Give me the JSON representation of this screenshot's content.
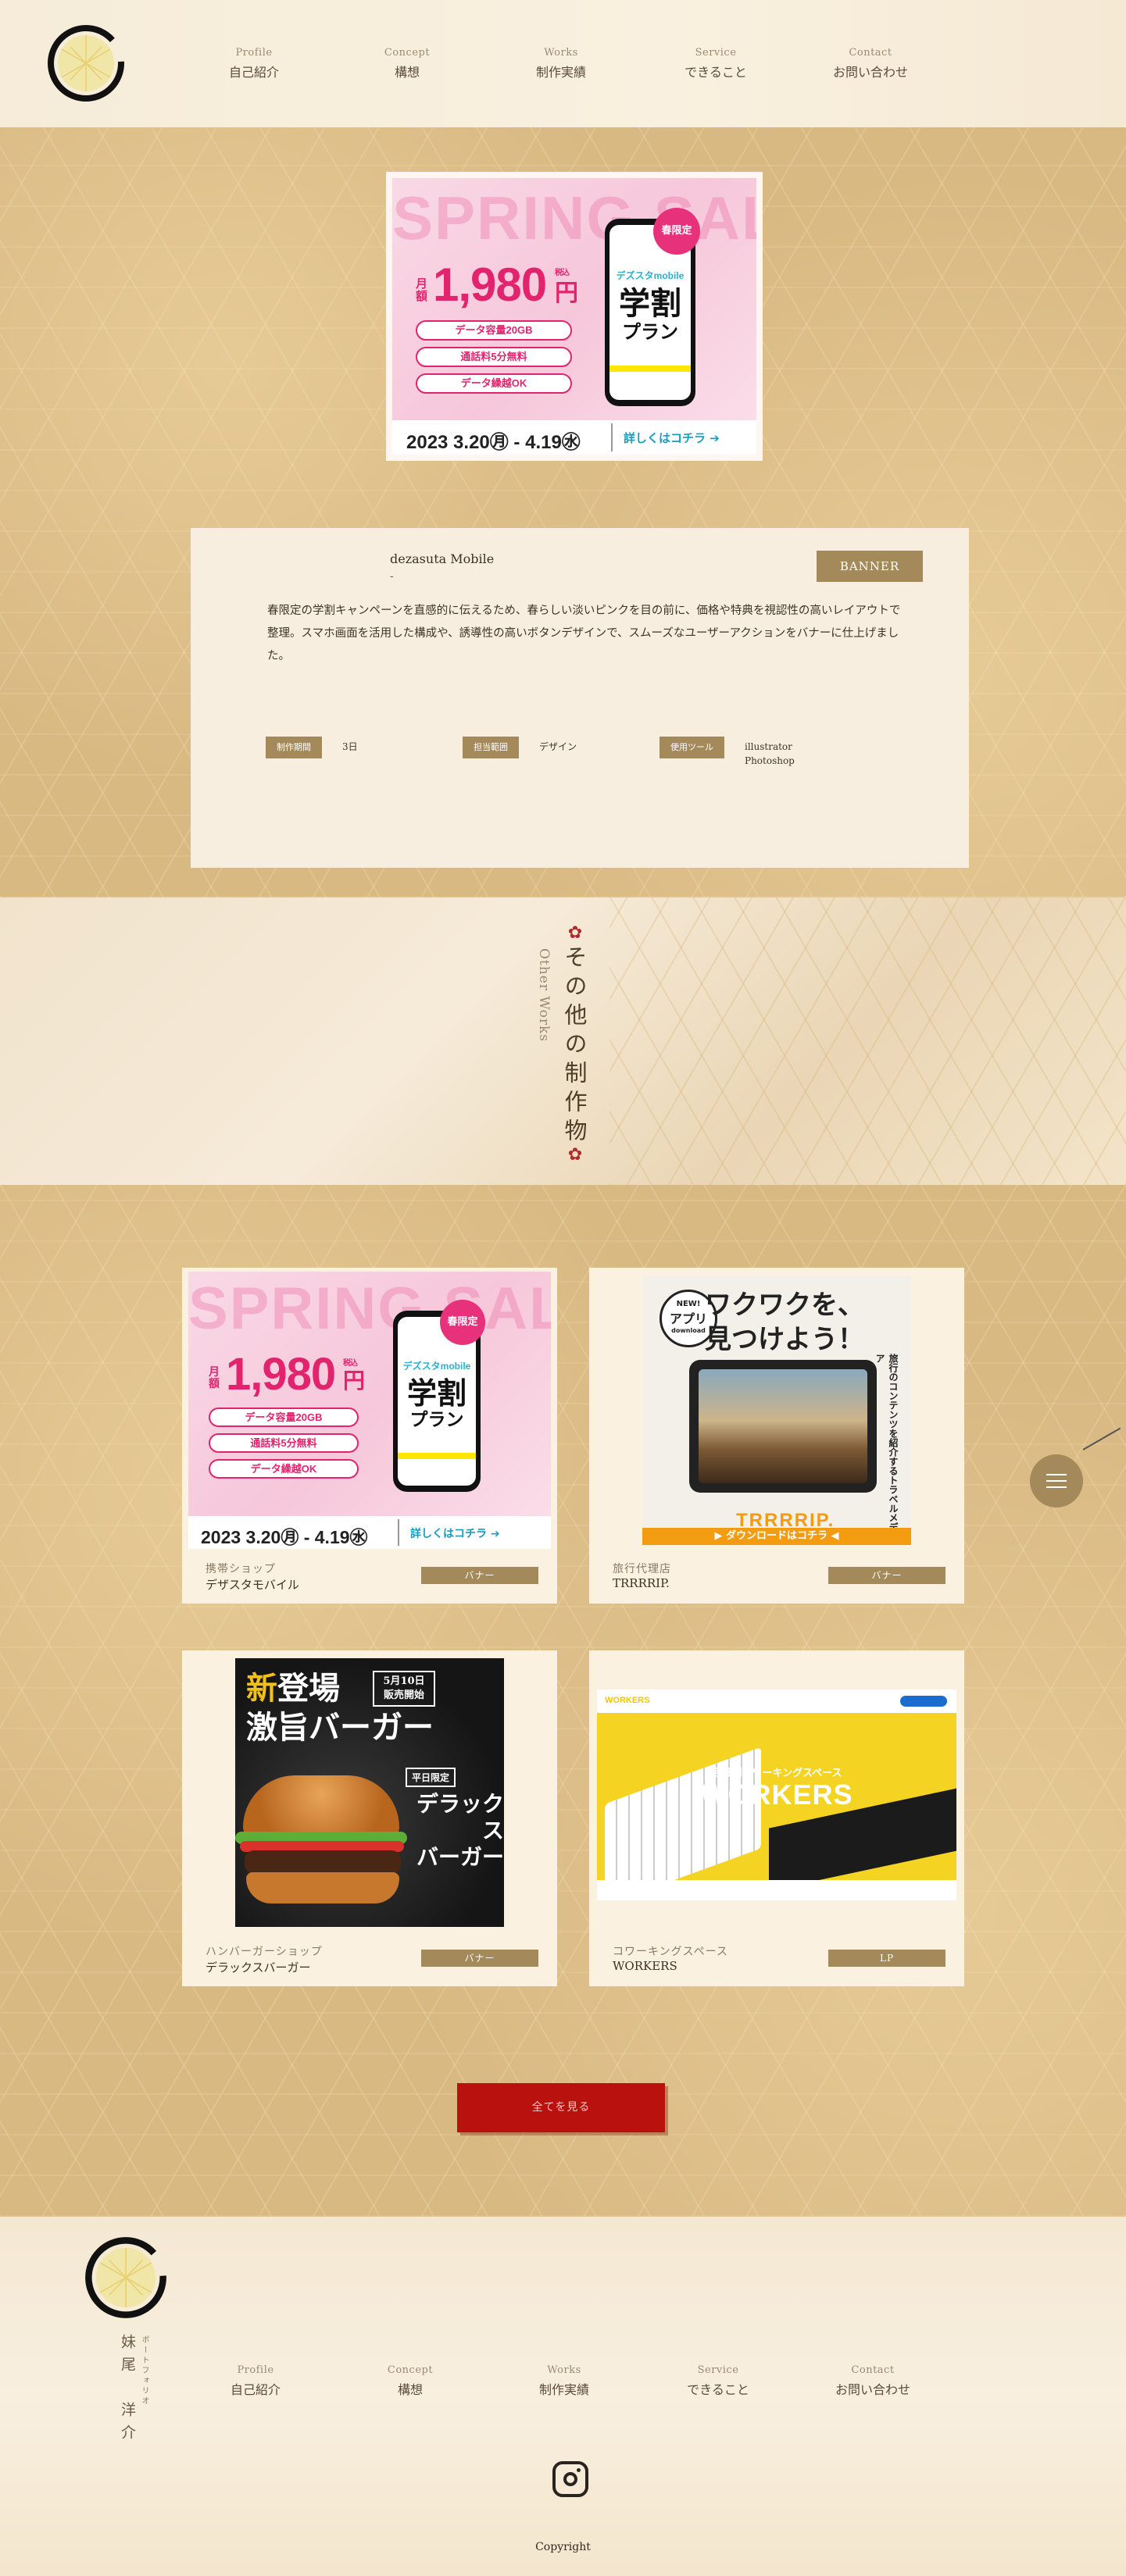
{
  "header": {
    "nav": [
      {
        "en": "Profile",
        "jp": "自己紹介"
      },
      {
        "en": "Concept",
        "jp": "構想"
      },
      {
        "en": "Works",
        "jp": "制作実績"
      },
      {
        "en": "Service",
        "jp": "できること"
      },
      {
        "en": "Contact",
        "jp": "お問い合わせ"
      }
    ]
  },
  "banner": {
    "title_bg": "SPRING SALE",
    "monthly": "月額",
    "price": "1,980",
    "yen": "円",
    "tax": "税込",
    "pills": [
      "データ容量20GB",
      "通話料5分無料",
      "データ繰越OK"
    ],
    "badge": "春限定",
    "brand": "デズスタmobile",
    "plan_big": "学割",
    "plan_small": "プラン",
    "dates": "2023 3.20㊊ - 4.19㊌",
    "cta": "詳しくはコチラ ➔"
  },
  "detail": {
    "client": "dezasuta Mobile",
    "dash": "-",
    "tag": "BANNER",
    "description": "春限定の学割キャンペーンを直感的に伝えるため、春らしい淡いピンクを目の前に、価格や特典を視認性の高いレイアウトで整理。スマホ画面を活用した構成や、誘導性の高いボタンデザインで、スムーズなユーザーアクションをバナーに仕上げました。",
    "meta": [
      {
        "label": "制作期間",
        "value": "3日"
      },
      {
        "label": "担当範囲",
        "value": "デザイン"
      },
      {
        "label": "使用ツール",
        "value": "illustrator\nPhotoshop"
      }
    ]
  },
  "other": {
    "title": "その他の制作物",
    "subtitle": "Other Works"
  },
  "works": [
    {
      "category": "携帯ショップ",
      "name": "デザスタモバイル",
      "tag": "バナー"
    },
    {
      "category": "旅行代理店",
      "name": "TRRRRIP.",
      "tag": "バナー"
    },
    {
      "category": "ハンバーガーショップ",
      "name": "デラックスバーガー",
      "tag": "バナー"
    },
    {
      "category": "コワーキングスペース",
      "name": "WORKERS",
      "tag": "LP"
    }
  ],
  "travel_thumb": {
    "head1": "ワクワクを、",
    "head2": "見つけよう！",
    "badge_new": "NEW!",
    "badge_app": "アプリ",
    "badge_dl": "download",
    "vtext": "旅行のコンテンツを紹介するトラベルメディア",
    "logo": "TRRRRIP.",
    "download": "▶ ダウンロードはコチラ ◀"
  },
  "burger_thumb": {
    "new": "新",
    "line1": "登場",
    "line2": "激旨バーガー",
    "date1": "5月10日",
    "date2": "販売開始",
    "limited": "平日限定",
    "deluxe1": "デラックス",
    "deluxe2": "バーガー"
  },
  "workers_thumb": {
    "logo": "WORKERS",
    "sub": "会員制コワーキングスペース",
    "title": "WORKERS"
  },
  "view_all": "全てを見る",
  "footer": {
    "name": "妹尾　洋介",
    "portfolio": "ポートフォリオ",
    "nav": [
      {
        "en": "Profile",
        "jp": "自己紹介"
      },
      {
        "en": "Concept",
        "jp": "構想"
      },
      {
        "en": "Works",
        "jp": "制作実績"
      },
      {
        "en": "Service",
        "jp": "できること"
      },
      {
        "en": "Contact",
        "jp": "お問い合わせ"
      }
    ],
    "copyright": "Copyright"
  },
  "colors": {
    "accent_gold": "#a4895b",
    "button_red": "#b8110e",
    "banner_pink": "#e2246e"
  },
  "icons": [
    "logo-emblem-icon",
    "menu-icon",
    "instagram-icon",
    "flower-icon"
  ]
}
